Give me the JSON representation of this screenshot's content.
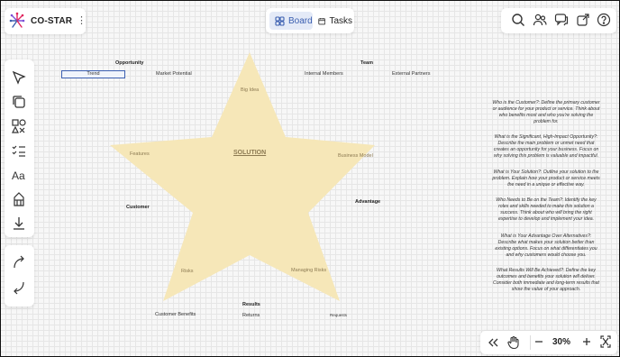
{
  "app": {
    "title": "CO-STAR"
  },
  "view_tabs": {
    "board": "Board",
    "tasks": "Tasks"
  },
  "toolbar_right": {
    "icons": [
      "search-icon",
      "users-icon",
      "chat-icon",
      "share-icon",
      "help-icon"
    ]
  },
  "left_tools": {
    "icons": [
      "select-icon",
      "sticky-note-icon",
      "shapes-icon",
      "checklist-icon",
      "text-icon",
      "template-icon",
      "import-icon"
    ]
  },
  "history": {
    "icons": [
      "undo-icon",
      "redo-icon"
    ]
  },
  "zoom": {
    "level": "30%"
  },
  "canvas": {
    "center_label": "SOLUTION",
    "star_fill": "#f6e7b8",
    "sections": {
      "opportunity": "Opportunity",
      "team": "Team",
      "customer": "Customer",
      "advantage": "Advantage",
      "results": "Results"
    },
    "notes": {
      "trend": "Trend",
      "market_potential": "Market Potential",
      "internal_members": "Internal Members",
      "external_partners": "External Partners",
      "big_idea": "Big Idea",
      "features": "Features",
      "business_model": "Business Model",
      "risks": "Risks",
      "managing_risks": "Managing Risks",
      "customer_benefits": "Customer Benefits",
      "returns": "Returns",
      "requests": "Requests"
    }
  },
  "descriptions": [
    "Who is the Customer?: Define the primary customer or audience for your product or service. Think about who benefits most and who you're solving the problem for.",
    "What is the Significant, High-Impact Opportunity?: Describe the main problem or unmet need that creates an opportunity for your business. Focus on why solving this problem is valuable and impactful.",
    "What is Your Solution?: Outline your solution to the problem. Explain how your product or service meets the need in a unique or effective way.",
    "Who Needs to Be on the Team?: Identify the key roles and skills needed to make this solution a success. Think about who will bring the right expertise to develop and implement your idea.",
    "What is Your Advantage Over Alternatives?: Describe what makes your solution better than existing options. Focus on what differentiates you and why customers would choose you.",
    "What Results Will Be Achieved?: Define the key outcomes and benefits your solution will deliver. Consider both immediate and long-term results that show the value of your approach."
  ]
}
